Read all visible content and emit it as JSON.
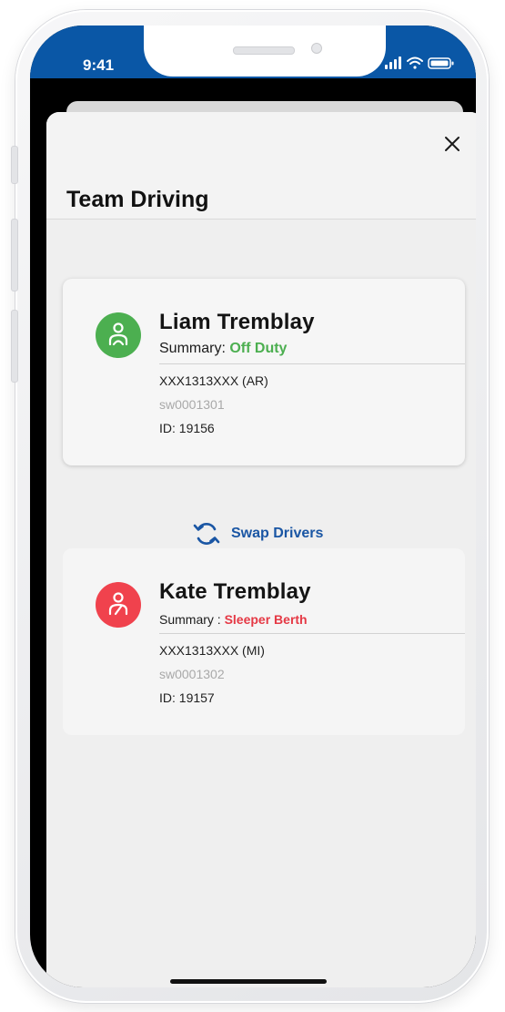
{
  "status_bar": {
    "time": "9:41",
    "bar_color": "#0a57a6"
  },
  "sheet": {
    "title": "Team Driving",
    "close_icon": "close-icon"
  },
  "drivers": [
    {
      "name": "Liam Tremblay",
      "summary_label": "Summary: ",
      "status": "Off Duty",
      "status_color": "#4caf50",
      "avatar_color": "#4caf50",
      "avatar_icon": "driver-icon",
      "vehicle": "XXX1313XXX (AR)",
      "username": "sw0001301",
      "id_text": "ID: 19156"
    },
    {
      "name": "Kate Tremblay",
      "summary_label": "Summary : ",
      "status": "Sleeper Berth",
      "status_color": "#e53945",
      "avatar_color": "#f0424d",
      "avatar_icon": "sleeper-driver-icon",
      "vehicle": "XXX1313XXX (MI)",
      "username": "sw0001302",
      "id_text": "ID: 19157"
    }
  ],
  "swap": {
    "label": "Swap Drivers",
    "icon": "swap-icon",
    "color": "#1a56a4"
  }
}
